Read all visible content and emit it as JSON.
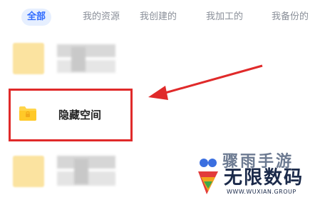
{
  "tabs": [
    {
      "label": "全部",
      "active": true
    },
    {
      "label": "我的资源",
      "active": false
    },
    {
      "label": "我创建的",
      "active": false
    },
    {
      "label": "我加工的",
      "active": false
    },
    {
      "label": "我备份的",
      "active": false
    }
  ],
  "folder": {
    "label": "隐藏空间",
    "icon": "folder-icon"
  },
  "colors": {
    "accent": "#2f6bff",
    "highlight": "#e02a2a",
    "folder": "#ffd54a"
  },
  "watermark": {
    "top_text": "骤雨手游",
    "main_text": "无限数码",
    "english": "WWW.WUXIAN.GROUP"
  }
}
